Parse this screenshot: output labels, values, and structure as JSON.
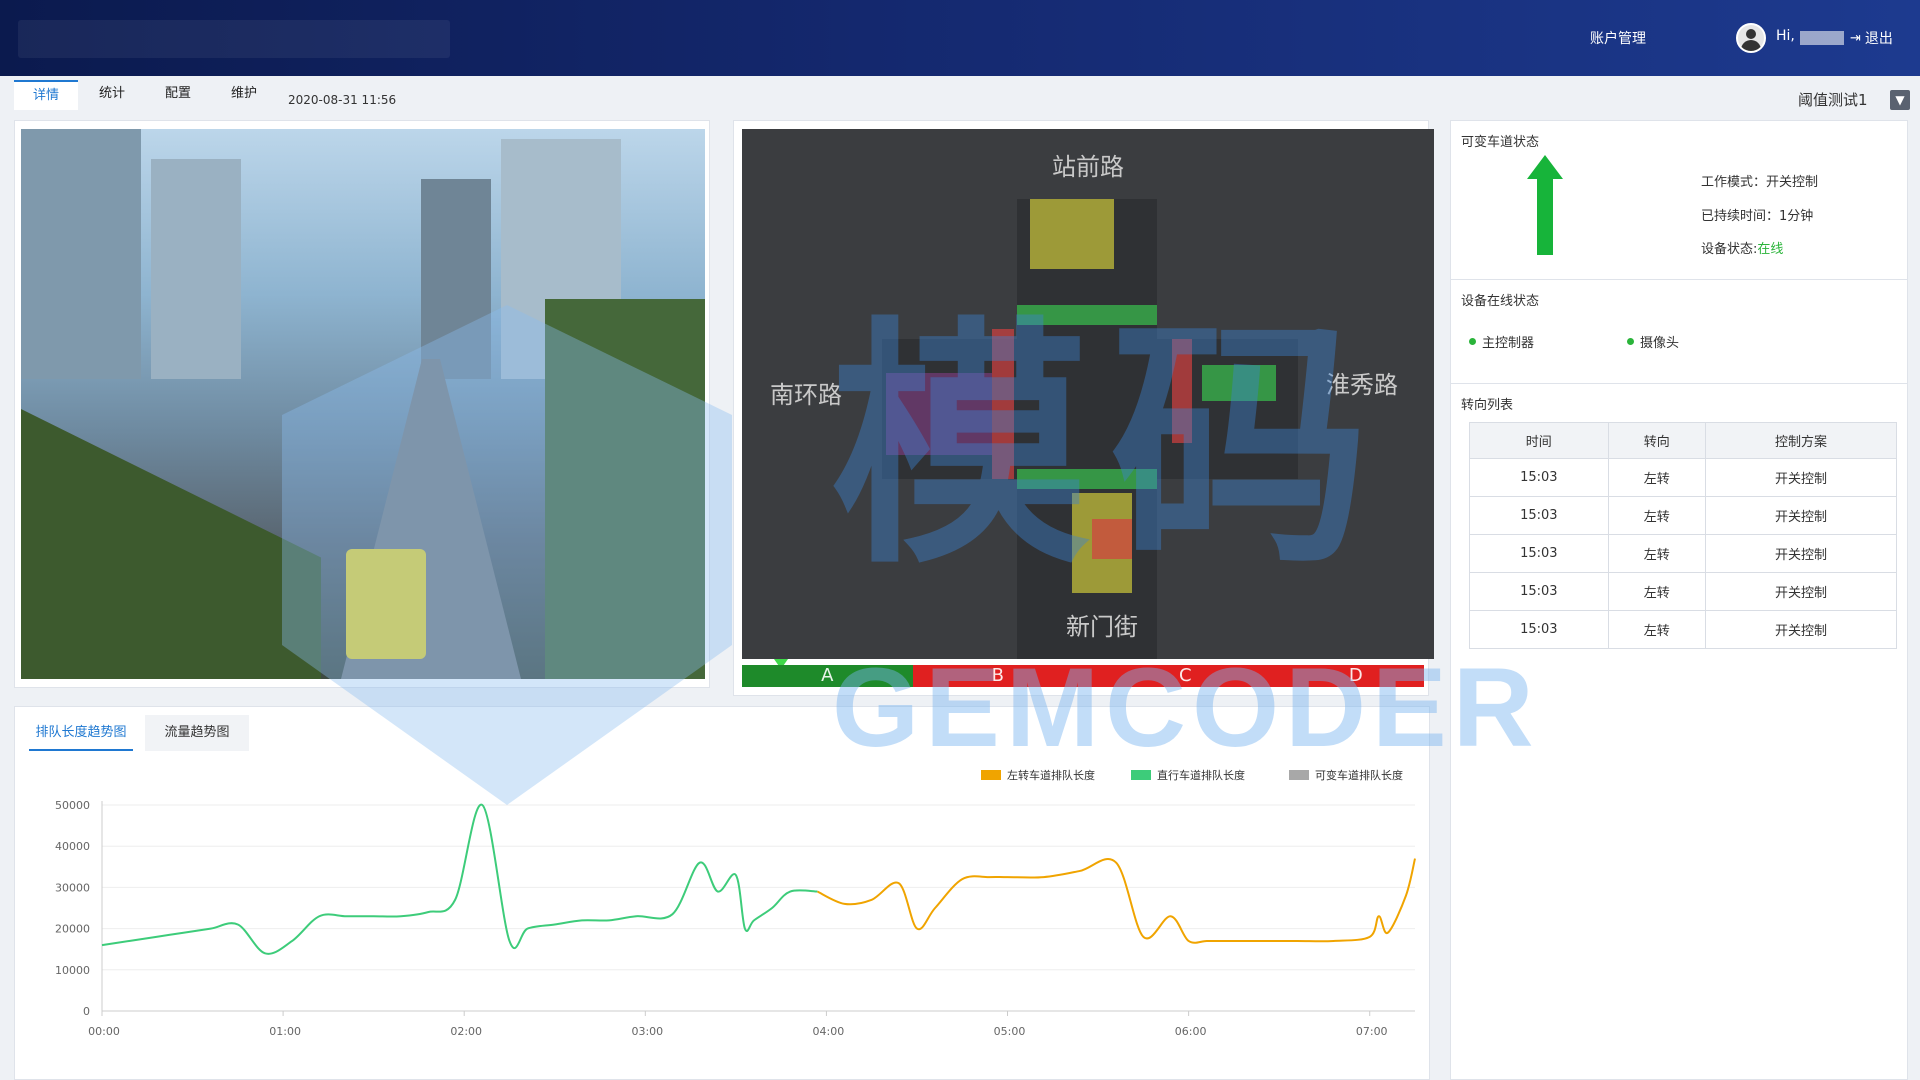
{
  "header": {
    "account": "账户管理",
    "hi": "Hi,",
    "logout": "退出"
  },
  "tabs": [
    "详情",
    "统计",
    "配置",
    "维护"
  ],
  "datetime": "2020-08-31   11:56",
  "threshold": "阈值测试1",
  "dropdown_icon": "chevron-down",
  "intersection": {
    "north": "站前路",
    "south": "新门街",
    "west": "南环路",
    "east": "淮秀路",
    "phases": [
      {
        "label": "A",
        "color": "#1e8a2a",
        "span": 0.25
      },
      {
        "label": "B",
        "color": "#e02020",
        "span": 0.25
      },
      {
        "label": "C",
        "color": "#e02020",
        "span": 0.3
      },
      {
        "label": "D",
        "color": "#e02020",
        "span": 0.2
      }
    ]
  },
  "lane_status": {
    "title": "可变车道状态",
    "mode": "工作模式：开关控制",
    "duration": "已持续时间：1分钟",
    "device_status_label": "设备状态:",
    "device_status_value": "在线"
  },
  "online_status": {
    "title": "设备在线状态",
    "devices": [
      "主控制器",
      "摄像头"
    ]
  },
  "turn_list": {
    "title": "转向列表",
    "headers": [
      "时间",
      "转向",
      "控制方案"
    ],
    "rows": [
      [
        "15:03",
        "左转",
        "开关控制"
      ],
      [
        "15:03",
        "左转",
        "开关控制"
      ],
      [
        "15:03",
        "左转",
        "开关控制"
      ],
      [
        "15:03",
        "左转",
        "开关控制"
      ],
      [
        "15:03",
        "左转",
        "开关控制"
      ]
    ]
  },
  "chart_tabs": [
    "排队长度趋势图",
    "流量趋势图"
  ],
  "watermark": {
    "big": "模码",
    "word": "GEMCODER"
  },
  "chart_data": {
    "type": "line",
    "ylim": [
      0,
      50000
    ],
    "yticks": [
      "0",
      "10000",
      "20000",
      "30000",
      "40000",
      "50000"
    ],
    "xticks": [
      "00:00",
      "01:00",
      "02:00",
      "03:00",
      "04:00",
      "05:00",
      "06:00",
      "07:00"
    ],
    "xlim": [
      0,
      7.25
    ],
    "series": [
      {
        "name": "左转车道排队长度",
        "color": "#f0a400",
        "x": [
          3.95,
          4.1,
          4.25,
          4.4,
          4.5,
          4.6,
          4.75,
          4.9,
          5.0,
          5.2,
          5.4,
          5.6,
          5.75,
          5.9,
          6.0,
          6.1,
          6.2,
          6.4,
          6.6,
          6.8,
          7.0,
          7.05,
          7.1,
          7.2,
          7.25
        ],
        "y": [
          29000,
          26000,
          27000,
          31000,
          20000,
          25000,
          32000,
          32500,
          32500,
          32500,
          34000,
          36000,
          18000,
          23000,
          17000,
          17000,
          17000,
          17000,
          17000,
          17000,
          18000,
          23000,
          19000,
          28000,
          37000
        ]
      },
      {
        "name": "直行车道排队长度",
        "color": "#3dcc7a",
        "x": [
          0,
          0.15,
          0.3,
          0.45,
          0.6,
          0.75,
          0.9,
          1.05,
          1.2,
          1.35,
          1.5,
          1.65,
          1.8,
          1.95,
          2.1,
          2.25,
          2.35,
          2.5,
          2.65,
          2.8,
          2.95,
          3.15,
          3.3,
          3.4,
          3.5,
          3.55,
          3.6,
          3.7,
          3.8,
          3.95
        ],
        "y": [
          16000,
          17000,
          18000,
          19000,
          20000,
          21000,
          14000,
          17000,
          23000,
          23000,
          23000,
          23000,
          24000,
          27000,
          50000,
          17000,
          20000,
          21000,
          22000,
          22000,
          23000,
          23500,
          36000,
          29000,
          33000,
          20000,
          22000,
          25000,
          29000,
          29000
        ]
      },
      {
        "name": "可变车道排队长度",
        "color": "#a8a8a8",
        "x": [],
        "y": []
      }
    ]
  }
}
